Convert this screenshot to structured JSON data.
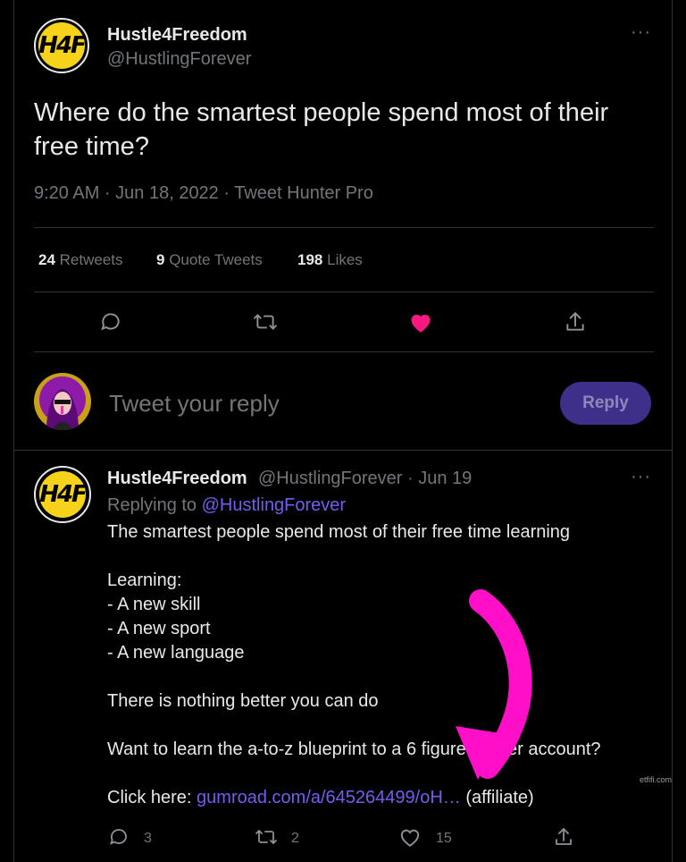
{
  "main_tweet": {
    "avatar_text": "H4F",
    "display_name": "Hustle4Freedom",
    "handle": "@HustlingForever",
    "more": "···",
    "text": "Where do the smartest people spend most of their free time?",
    "meta": "9:20 AM · Jun 18, 2022 · Tweet Hunter Pro",
    "stats": {
      "retweets_count": "24",
      "retweets_label": "Retweets",
      "quotes_count": "9",
      "quotes_label": "Quote Tweets",
      "likes_count": "198",
      "likes_label": "Likes"
    }
  },
  "reply_box": {
    "placeholder": "Tweet your reply",
    "button_label": "Reply"
  },
  "reply_tweet": {
    "avatar_text": "H4F",
    "display_name": "Hustle4Freedom",
    "handle_time": "@HustlingForever · Jun 19",
    "more": "···",
    "replying_prefix": "Replying to",
    "replying_handle": "@HustlingForever",
    "lines": [
      "The smartest people spend most of their free time learning",
      "Learning:",
      "- A new skill",
      "- A new sport",
      "- A new language",
      "There is nothing better you can do",
      "Want to learn the a-to-z blueprint to a 6 figure Twitter account?"
    ],
    "click_prefix": "Click here:",
    "link_text": "gumroad.com/a/645264499/oH…",
    "affiliate": "(affiliate)",
    "counts": {
      "replies": "3",
      "retweets": "2",
      "likes": "15"
    }
  },
  "watermark": "etfifi.com",
  "colors": {
    "accent": "#6f5ff0",
    "like": "#f91880",
    "arrow": "#ff10c8",
    "avatar_yellow": "#f7d21a"
  }
}
